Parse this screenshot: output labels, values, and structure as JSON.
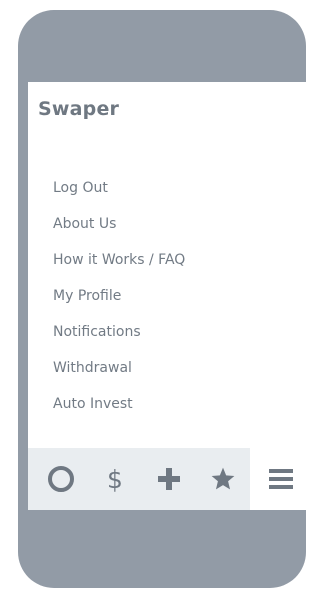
{
  "app": {
    "title": "Swaper"
  },
  "menu": {
    "items": [
      {
        "label": "Log Out"
      },
      {
        "label": "About Us"
      },
      {
        "label": "How it Works / FAQ"
      },
      {
        "label": "My Profile"
      },
      {
        "label": "Notifications"
      },
      {
        "label": "Withdrawal"
      },
      {
        "label": "Auto Invest"
      }
    ]
  },
  "tabbar": {
    "tabs": [
      {
        "icon": "circle-icon"
      },
      {
        "icon": "dollar-icon",
        "glyph": "$"
      },
      {
        "icon": "plus-icon"
      },
      {
        "icon": "star-icon"
      },
      {
        "icon": "hamburger-menu-icon",
        "active": true
      }
    ]
  },
  "colors": {
    "device_frame": "#929ba6",
    "text": "#727b85",
    "tabbar_background": "#e9edf0",
    "icon": "#6f7882"
  }
}
